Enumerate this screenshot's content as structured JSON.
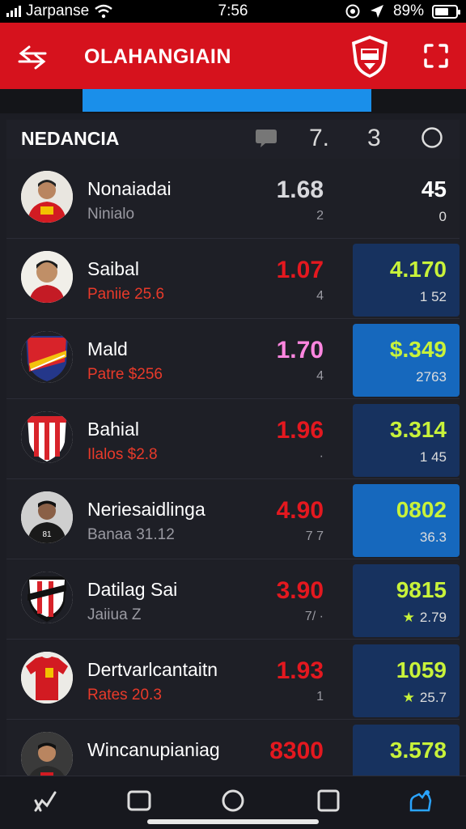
{
  "status": {
    "carrier": "Jarpanse",
    "time": "7:56",
    "battery": "89%"
  },
  "appbar": {
    "title": "OLAHANGIAIN",
    "crest_icon": "club-crest-icon"
  },
  "progress": {
    "fraction": 0.62,
    "color": "#1a8fea"
  },
  "section": {
    "label": "NEDANCIA",
    "col2": "7.",
    "col3": "3"
  },
  "rows": [
    {
      "name": "Nonaiadai",
      "sub": "Ninialo",
      "sub_style": "gray",
      "odds": "1.68",
      "odds_style": "white",
      "small": "2",
      "box_val": "45",
      "box_sub": "0",
      "box_style": "none",
      "avatar": "player-red-avatar"
    },
    {
      "name": "Saibal",
      "sub": "Paniie 25.6",
      "sub_style": "red",
      "odds": "1.07",
      "odds_style": "red",
      "small": "4",
      "box_val": "4.170",
      "box_sub": "1 52",
      "box_style": "dark",
      "avatar": "player-portrait-avatar"
    },
    {
      "name": "Mald",
      "sub": "Patre $256",
      "sub_style": "red",
      "odds": "1.70",
      "odds_style": "pink",
      "small": "4",
      "box_val": "$.349",
      "box_sub": "2763",
      "box_style": "bright",
      "avatar": "shield-crest-avatar"
    },
    {
      "name": "Bahial",
      "sub": "Ilalos $2.8",
      "sub_style": "red",
      "odds": "1.96",
      "odds_style": "red",
      "small": "·",
      "box_val": "3.314",
      "box_sub": "1 45",
      "box_style": "dark",
      "avatar": "striped-crest-avatar"
    },
    {
      "name": "Neriesaidlinga",
      "sub": "Banaa 31.12",
      "sub_style": "gray",
      "odds": "4.90",
      "odds_style": "red",
      "small": "7 7",
      "box_val": "0802",
      "box_sub": "36.3",
      "box_style": "bright",
      "avatar": "player-black-avatar"
    },
    {
      "name": "Datilag Sai",
      "sub": "Jaiiua Z",
      "sub_style": "gray",
      "odds": "3.90",
      "odds_style": "red",
      "small": "7/ ·",
      "box_val": "9815",
      "box_sub": "2.79",
      "box_star": "★",
      "box_style": "dark",
      "avatar": "diagonal-crest-avatar"
    },
    {
      "name": "Dertvarlcantaitn",
      "sub": "Rates 20.3",
      "sub_style": "red",
      "odds": "1.93",
      "odds_style": "red",
      "small": "1",
      "box_val": "1059",
      "box_sub": "25.7",
      "box_star": "★",
      "box_style": "dark",
      "avatar": "jersey-red-avatar"
    },
    {
      "name": "Wincanupianiag",
      "sub": "",
      "sub_style": "gray",
      "odds": "8300",
      "odds_style": "red",
      "small": "",
      "box_val": "3.578",
      "box_sub": "",
      "box_style": "dark",
      "avatar": "player-team-avatar"
    }
  ],
  "navbar": {
    "items": [
      "stats-icon",
      "square-icon",
      "circle-icon",
      "tabs-icon",
      "team-icon"
    ]
  }
}
